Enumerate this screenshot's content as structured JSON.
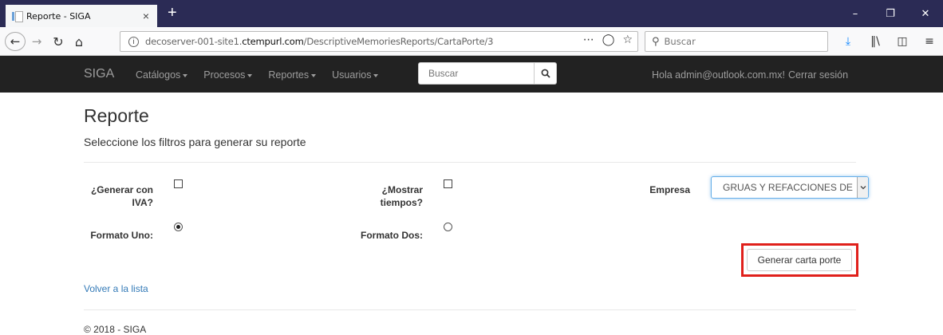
{
  "browser": {
    "tab_title": "Reporte - SIGA",
    "tab_close": "×",
    "new_tab": "+",
    "url_host": "decoserver-001-site1.",
    "url_domain": "ctempurl.com",
    "url_path": "/DescriptiveMemoriesReports/CartaPorte/3",
    "search_placeholder": "Buscar"
  },
  "site_nav": {
    "brand": "SIGA",
    "menu": [
      "Catálogos",
      "Procesos",
      "Reportes",
      "Usuarios"
    ],
    "search_placeholder": "Buscar",
    "greeting": "Hola admin@outlook.com.mx!",
    "logout": "Cerrar sesión"
  },
  "page": {
    "title": "Reporte",
    "subtitle": "Seleccione los filtros para generar su reporte"
  },
  "form": {
    "iva_label": "¿Generar con IVA?",
    "iva_checked": false,
    "tiempos_label": "¿Mostrar tiempos?",
    "tiempos_checked": false,
    "empresa_label": "Empresa",
    "empresa_value": "GRUAS Y REFACCIONES DE",
    "formato_uno_label": "Formato Uno:",
    "formato_uno_selected": true,
    "formato_dos_label": "Formato Dos:",
    "formato_dos_selected": false,
    "generate_button": "Generar carta porte"
  },
  "links": {
    "back": "Volver a la lista"
  },
  "footer": {
    "text": "© 2018 - SIGA"
  },
  "colors": {
    "navbar_bg": "#222222",
    "link": "#337ab7",
    "highlight": "#e0201b"
  }
}
